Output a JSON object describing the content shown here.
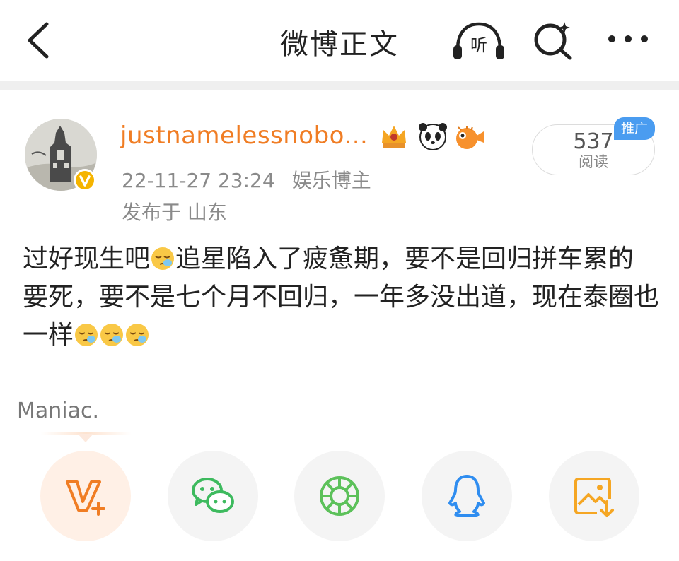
{
  "header": {
    "title": "微博正文",
    "listen_label": "听"
  },
  "author": {
    "name": "justnamelessnobo...",
    "timestamp": "22-11-27 23:24",
    "role": "娱乐博主",
    "location": "发布于 山东",
    "badge_icons": [
      "crown-icon",
      "panda-icon",
      "pufferfish-icon"
    ]
  },
  "reads": {
    "count": "537",
    "label": "阅读",
    "promo": "推广"
  },
  "post": {
    "part1": "过好现生吧",
    "part2": "追星陷入了疲惫期，要不是回归拼车累的要死，要不是七个月不回归，一年多没出道，现在泰圈也一样",
    "emoji": "sleepy-face-emoji"
  },
  "share": {
    "label": "Maniac.",
    "targets": [
      "vlog-plus-icon",
      "wechat-icon",
      "moments-icon",
      "qq-icon",
      "save-image-icon"
    ]
  },
  "colors": {
    "accent": "#f07d24",
    "verified": "#f5b400",
    "wechat": "#3dba5e",
    "qq": "#2f8df0",
    "promo": "#4a9cf0"
  }
}
